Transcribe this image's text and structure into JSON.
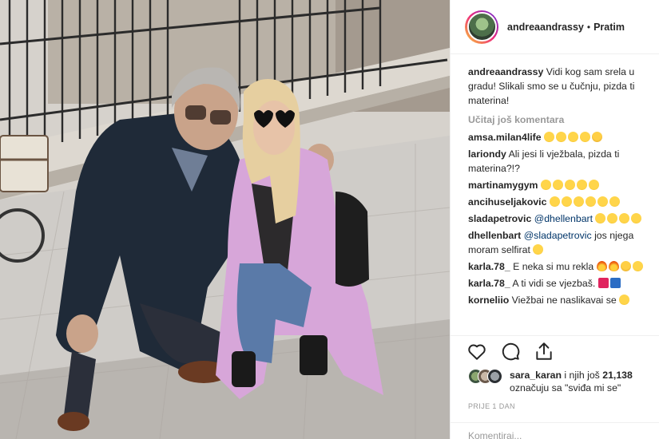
{
  "post": {
    "photo_alt": "",
    "header": {
      "username": "andreaandrassy",
      "separator": "•",
      "follow_label": "Pratim"
    },
    "caption": {
      "username": "andreaandrassy",
      "text": "Vidi kog sam srela u gradu! Slikali smo se u čučnju, pizda ti materina!"
    },
    "load_more_label": "Učitaj još komentara",
    "comments": [
      {
        "username": "amsa.milan4life",
        "text": "",
        "emoji": [
          "laugh",
          "laugh",
          "laugh",
          "laugh",
          "hide"
        ]
      },
      {
        "username": "lariondy",
        "text": "Ali jesi li vježbala, pizda ti materina?!?",
        "emoji": []
      },
      {
        "username": "martinamygym",
        "text": "",
        "emoji": [
          "laugh",
          "laugh",
          "laugh",
          "laugh",
          "laugh"
        ]
      },
      {
        "username": "ancihuseljakovic",
        "text": "",
        "emoji": [
          "laugh",
          "laugh",
          "laugh",
          "laugh",
          "laugh",
          "laugh"
        ]
      },
      {
        "username": "sladapetrovic",
        "mention": "@dhellenbart",
        "text": "",
        "emoji": [
          "laugh",
          "laugh",
          "laugh",
          "laugh"
        ]
      },
      {
        "username": "dhellenbart",
        "mention": "@sladapetrovic",
        "text": "jos njega moram selfirat",
        "emoji": [
          "laugh"
        ]
      },
      {
        "username": "karla.78_",
        "text": "E neka si mu rekla",
        "emoji": [
          "fire",
          "fire",
          "hide",
          "laugh"
        ]
      },
      {
        "username": "karla.78_",
        "text": "A ti vidi se vjezbaš.",
        "emoji": [
          "heart",
          "blue"
        ]
      },
      {
        "username": "korneliio",
        "text": "Viežbai ne naslikavai se",
        "emoji": [
          "laugh"
        ]
      }
    ],
    "actions": {
      "like_icon": "heart-icon",
      "comment_icon": "comment-icon",
      "share_icon": "share-icon"
    },
    "likes": {
      "first_user": "sara_karan",
      "middle": " i njih još ",
      "count": "21,138",
      "suffix": "označuju sa \"sviđa mi se\""
    },
    "time": "PRIJE 1 DAN",
    "add_comment_placeholder": "Komentiraj..."
  }
}
